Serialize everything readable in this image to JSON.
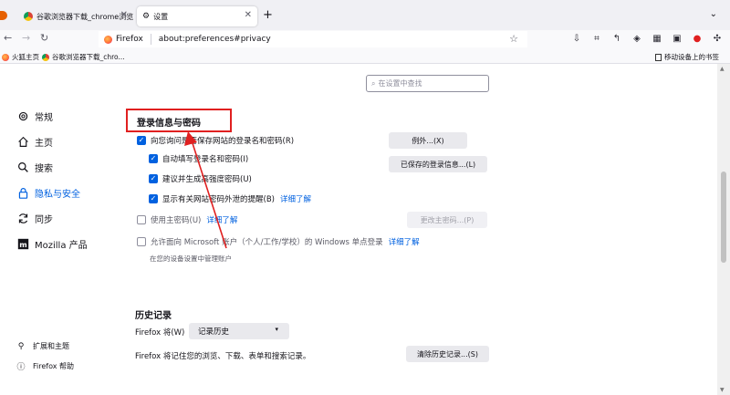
{
  "tabs": [
    {
      "label": "谷歌浏览器下载_chrome浏览器",
      "active": false
    },
    {
      "label": "设置",
      "active": true
    }
  ],
  "urlbar": {
    "brand": "Firefox",
    "url": "about:preferences#privacy"
  },
  "bookmarks": {
    "items": [
      "火狐主页",
      "谷歌浏览器下载_chro..."
    ],
    "mobile": "移动设备上的书签"
  },
  "search": {
    "placeholder": "在设置中查找"
  },
  "sidebar": {
    "categories": [
      "常规",
      "主页",
      "搜索",
      "隐私与安全",
      "同步",
      "Mozilla 产品"
    ],
    "selected": "隐私与安全",
    "footer": [
      "扩展和主题",
      "Firefox 帮助"
    ]
  },
  "logins": {
    "title": "登录信息与密码",
    "ask_save": "向您询问是否保存网站的登录名和密码(R)",
    "autofill": "自动填写登录名和密码(I)",
    "suggest": "建议并生成高强度密码(U)",
    "breach": "显示有关网站密码外泄的提醒(B)",
    "breach_link": "详细了解",
    "primary_pw": "使用主密码(U)",
    "primary_link": "详细了解",
    "windows_sso": "允许面向 Microsoft 账户（个人/工作/学校）的 Windows 单点登录",
    "windows_link": "详细了解",
    "windows_sub": "在您的设备设置中管理账户",
    "exceptions_btn": "例外...(X)",
    "saved_btn": "已保存的登录信息...(L)",
    "change_pw_btn": "更改主密码...(P)"
  },
  "history": {
    "title": "历史记录",
    "will_label": "Firefox 将(W)",
    "mode": "记录历史",
    "desc": "Firefox 将记住您的浏览、下载、表单和搜索记录。",
    "clear_btn": "清除历史记录...(S)"
  },
  "colors": {
    "accent": "#0061e0",
    "annotation": "#e02020"
  }
}
